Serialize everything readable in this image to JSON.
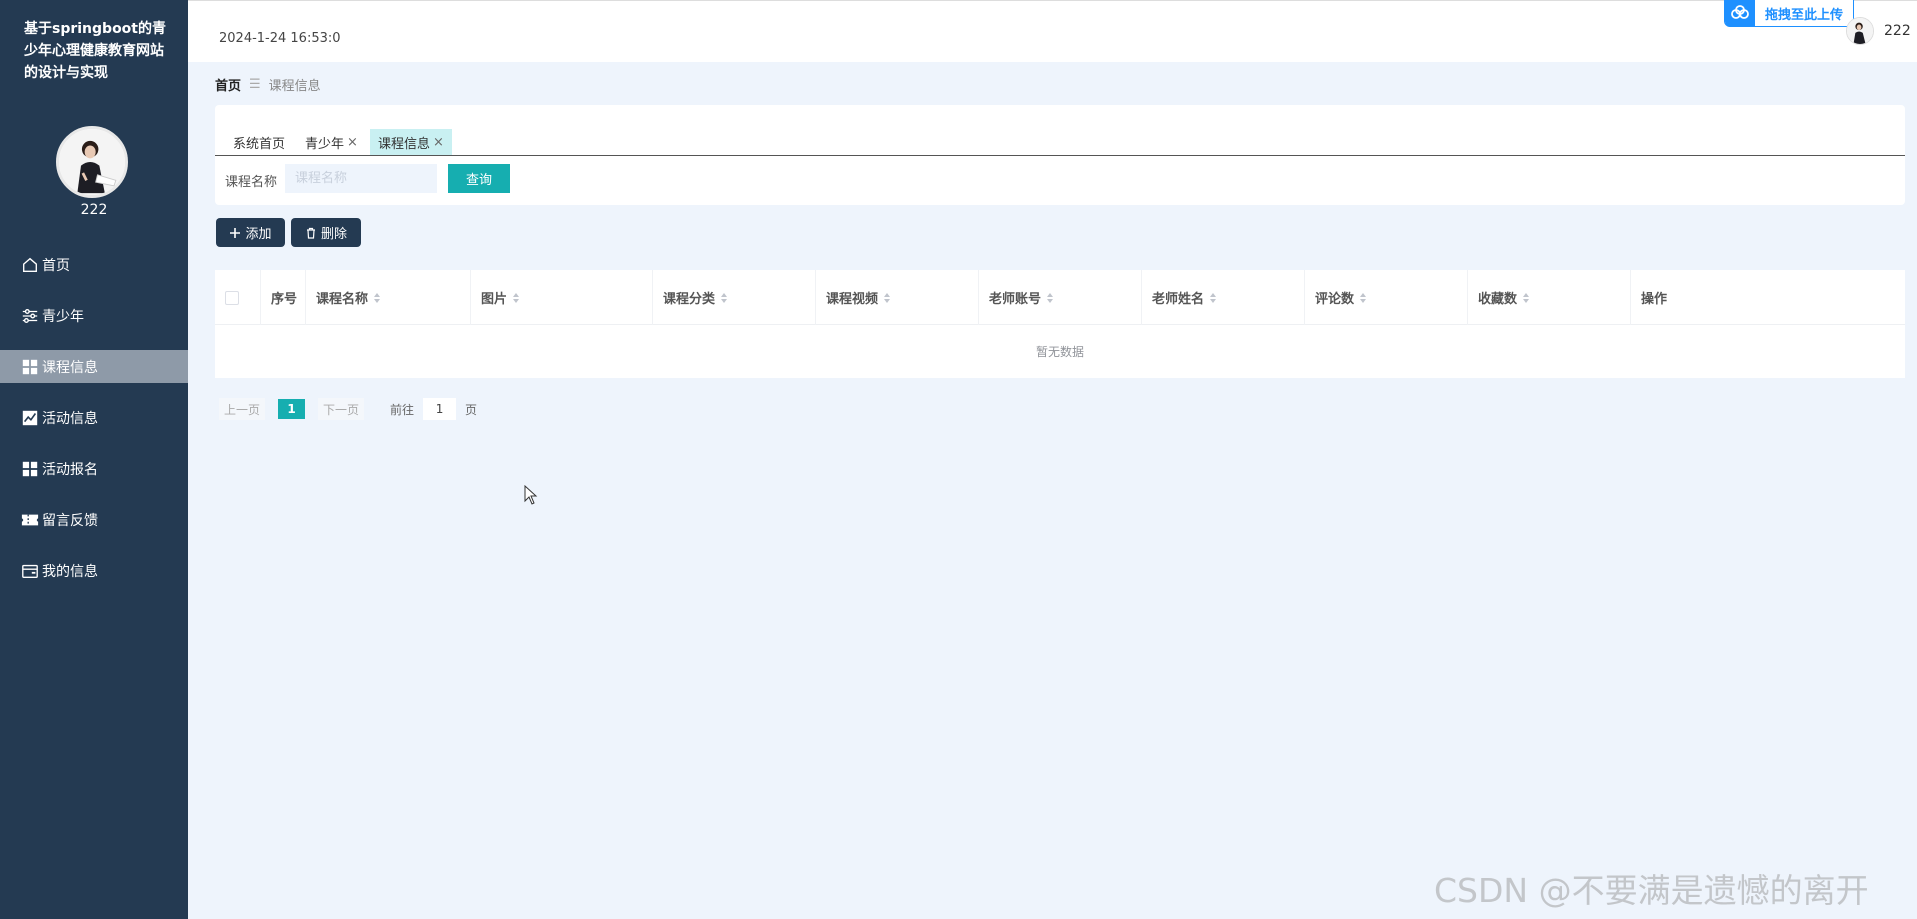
{
  "sidebar": {
    "app_title": "基于springboot的青少年心理健康教育网站的设计与实现",
    "username": "222",
    "items": [
      {
        "label": "首页",
        "icon": "home-icon",
        "active": false
      },
      {
        "label": "青少年",
        "icon": "sliders-icon",
        "active": false
      },
      {
        "label": "课程信息",
        "icon": "grid-icon",
        "active": true
      },
      {
        "label": "活动信息",
        "icon": "chart-icon",
        "active": false
      },
      {
        "label": "活动报名",
        "icon": "grid-icon",
        "active": false
      },
      {
        "label": "留言反馈",
        "icon": "ticket-icon",
        "active": false
      },
      {
        "label": "我的信息",
        "icon": "wallet-icon",
        "active": false
      }
    ]
  },
  "header": {
    "datetime": "2024-1-24 16:53:0",
    "upload_label": "拖拽至此上传",
    "username": "222"
  },
  "breadcrumb": {
    "home": "首页",
    "current": "课程信息"
  },
  "tabs": [
    {
      "label": "系统首页",
      "closable": false,
      "active": false
    },
    {
      "label": "青少年",
      "closable": true,
      "active": false
    },
    {
      "label": "课程信息",
      "closable": true,
      "active": true
    }
  ],
  "search": {
    "label": "课程名称",
    "placeholder": "课程名称",
    "button": "查询"
  },
  "actions": {
    "add": "添加",
    "delete": "删除"
  },
  "table": {
    "columns": [
      {
        "label": "序号",
        "sortable": false
      },
      {
        "label": "课程名称",
        "sortable": true
      },
      {
        "label": "图片",
        "sortable": true
      },
      {
        "label": "课程分类",
        "sortable": true
      },
      {
        "label": "课程视频",
        "sortable": true
      },
      {
        "label": "老师账号",
        "sortable": true
      },
      {
        "label": "老师姓名",
        "sortable": true
      },
      {
        "label": "评论数",
        "sortable": true
      },
      {
        "label": "收藏数",
        "sortable": true
      },
      {
        "label": "操作",
        "sortable": false
      }
    ],
    "empty_text": "暂无数据"
  },
  "pagination": {
    "prev": "上一页",
    "current_page": "1",
    "next": "下一页",
    "goto_label": "前往",
    "goto_value": "1",
    "unit": "页"
  },
  "watermark": "CSDN @不要满是遗憾的离开",
  "colors": {
    "sidebar_bg": "#243a52",
    "accent": "#16aeb0",
    "page_bg": "#eef4fc"
  }
}
